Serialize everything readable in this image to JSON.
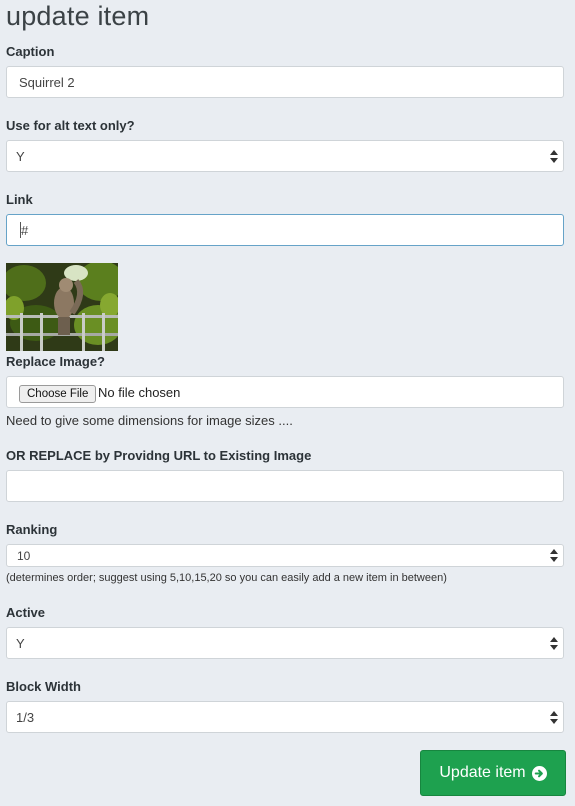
{
  "page": {
    "title": "update item"
  },
  "caption": {
    "label": "Caption",
    "value": "Squirrel 2"
  },
  "alt_text": {
    "label": "Use for alt text only?",
    "value": "Y"
  },
  "link": {
    "label": "Link",
    "value": "#"
  },
  "replace_image": {
    "label": "Replace Image?",
    "button_label": "Choose File",
    "status": "No file chosen",
    "help": "Need to give some dimensions for image sizes ...."
  },
  "replace_url": {
    "label": "OR REPLACE by Providng URL to Existing Image",
    "value": ""
  },
  "ranking": {
    "label": "Ranking",
    "value": "10",
    "help": "(determines order; suggest using 5,10,15,20 so you can easily add a new item in between)"
  },
  "active": {
    "label": "Active",
    "value": "Y"
  },
  "block_width": {
    "label": "Block Width",
    "value": "1/3"
  },
  "submit": {
    "label": "Update item",
    "icon": "arrow-circle-right-icon",
    "color": "#1ea14f"
  }
}
